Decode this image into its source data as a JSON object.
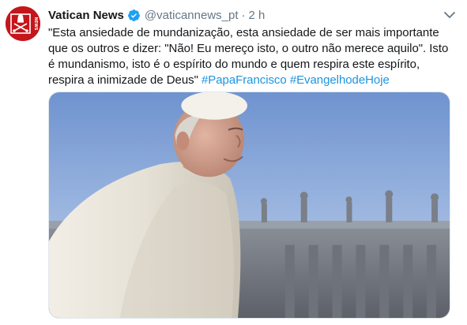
{
  "account": {
    "display_name": "Vatican News",
    "handle": "@vaticannews_pt",
    "separator": "·",
    "time": "2 h",
    "avatar_label": "NEWS",
    "verified": true
  },
  "tweet": {
    "lines": [
      "\"Esta ansiedade de mundanização, esta ansiedade de ser mais importante",
      "que os outros e dizer: \"Não! Eu mereço isto, o outro não merece aquilo\". Isto",
      "é mundanismo, isto é o espírito do mundo e quem respira este espírito,",
      "respira a inimizade de Deus\""
    ],
    "hashtags": [
      "#PapaFrancisco",
      "#EvangelhodeHoje"
    ]
  },
  "colors": {
    "brand_red": "#c4161c",
    "link_blue": "#1b95e0",
    "verified_blue": "#1da1f2",
    "muted": "#657786"
  },
  "icons": {
    "verified": "verified-badge-icon",
    "caret": "chevron-down-icon",
    "avatar": "vatican-keys-logo"
  }
}
